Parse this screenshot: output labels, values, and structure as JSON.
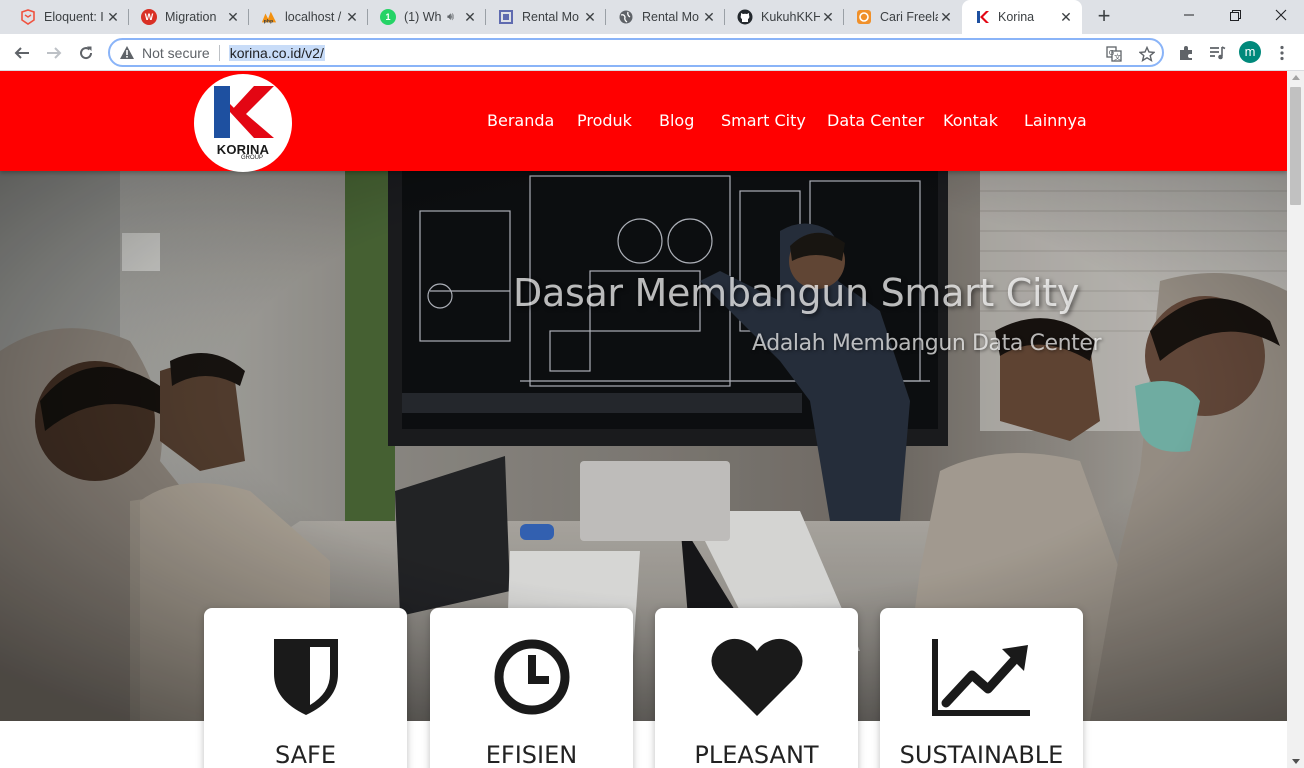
{
  "browser": {
    "tabs": [
      {
        "label": "Eloquent: I",
        "favicon": "laravel-icon",
        "color": "#f05340",
        "active": false
      },
      {
        "label": "Migration",
        "favicon": "dewaweb-icon",
        "color": "#d93025",
        "active": false
      },
      {
        "label": "localhost /",
        "favicon": "phpmyadmin-icon",
        "color": "#f29111",
        "active": false
      },
      {
        "label": "(1) Wh",
        "favicon": "whatsapp-icon",
        "color": "#25d366",
        "active": false,
        "badge": "1"
      },
      {
        "label": "Rental Mo",
        "favicon": "document-icon",
        "color": "#5f6bb0",
        "active": false
      },
      {
        "label": "Rental Mo",
        "favicon": "globe-icon",
        "color": "#5f6368",
        "active": false
      },
      {
        "label": "KukuhKKH",
        "favicon": "github-icon",
        "color": "#24292e",
        "active": false
      },
      {
        "label": "Cari Freela",
        "favicon": "freelancer-icon",
        "color": "#f0902a",
        "active": false
      },
      {
        "label": "Korina",
        "favicon": "korina-icon",
        "color": "#e30613",
        "active": true
      }
    ],
    "new_tab_label": "+",
    "window_controls": {
      "minimize": "—",
      "restore": "❐",
      "close": "✕"
    },
    "security_label": "Not secure",
    "url": "korina.co.id/v2/",
    "profile_initial": "m"
  },
  "site": {
    "logo_text": "KORINA",
    "logo_sub": "GROUP",
    "menu": [
      "Beranda",
      "Produk",
      "Blog",
      "Smart City",
      "Data Center",
      "Kontak",
      "Lainnya"
    ],
    "hero": {
      "title": "Dasar Membangun Smart City",
      "subtitle": "Adalah Membangun Data Center"
    },
    "features": [
      {
        "label": "SAFE",
        "icon": "shield-icon"
      },
      {
        "label": "EFISIEN",
        "icon": "clock-icon"
      },
      {
        "label": "PLEASANT",
        "icon": "heart-icon"
      },
      {
        "label": "SUSTAINABLE",
        "icon": "chart-up-icon"
      }
    ],
    "colors": {
      "brand_red": "#ff0000",
      "logo_blue": "#1e50a0"
    }
  }
}
